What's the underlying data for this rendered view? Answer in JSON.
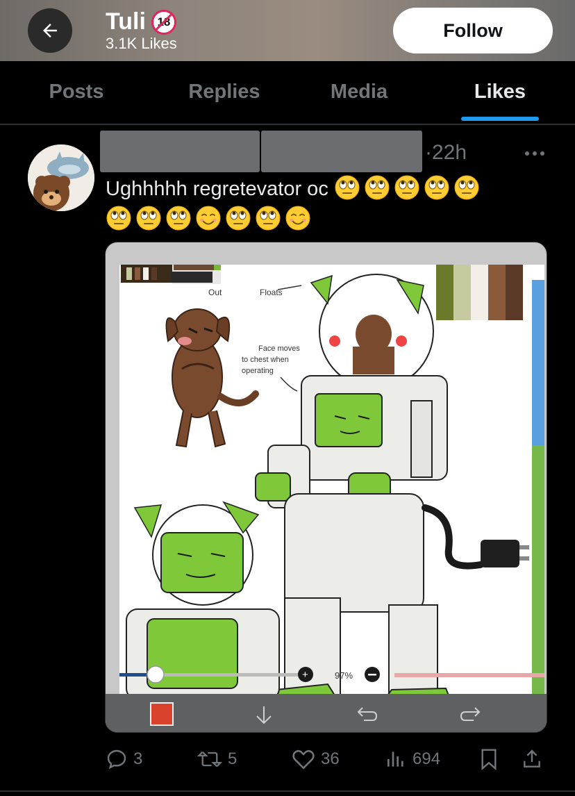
{
  "header": {
    "name": "Tuli",
    "age_badge": "18",
    "likes_count": "3.1K Likes",
    "follow_label": "Follow",
    "back_icon": "arrow-left-icon"
  },
  "tabs": [
    {
      "label": "Posts",
      "active": false
    },
    {
      "label": "Replies",
      "active": false
    },
    {
      "label": "Media",
      "active": false
    },
    {
      "label": "Likes",
      "active": true
    }
  ],
  "accent_color": "#1d9bf0",
  "post": {
    "time": "·22h",
    "text": "Ughhhhh regretevator oc",
    "emoji_line_1": [
      "face-with-rolling-eyes",
      "face-with-rolling-eyes",
      "face-with-rolling-eyes",
      "face-with-rolling-eyes",
      "face-with-rolling-eyes"
    ],
    "emoji_line_2": [
      "face-with-rolling-eyes",
      "face-with-rolling-eyes",
      "face-with-rolling-eyes",
      "smiling-face",
      "face-with-rolling-eyes",
      "face-with-rolling-eyes",
      "smiling-face"
    ],
    "image": {
      "annotations": {
        "out": "Out",
        "floats": "Floats",
        "face_note_1": "Face moves",
        "face_note_2": "to chest when",
        "face_note_3": "operating"
      },
      "zoom_label": "97%",
      "palette": [
        "#6b7a2a",
        "#c7c9a0",
        "#f3efe8",
        "#8a5a3a",
        "#5a3a26"
      ]
    },
    "actions": {
      "replies": "3",
      "reposts": "5",
      "likes": "36",
      "views": "694"
    }
  }
}
